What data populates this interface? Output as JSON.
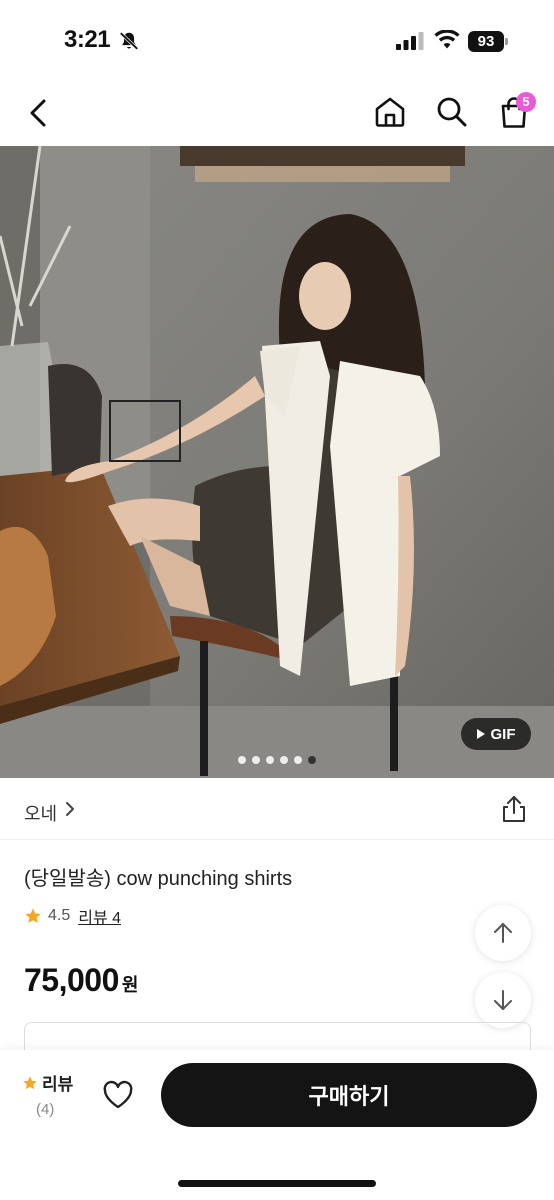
{
  "status_bar": {
    "time": "3:21",
    "battery": "93"
  },
  "nav": {
    "cart_badge": "5"
  },
  "hero": {
    "gif_label": "GIF",
    "slide_count": 6,
    "active_slide": 6
  },
  "product": {
    "brand": "오네",
    "title": "(당일발송) cow punching shirts",
    "rating": "4.5",
    "review_link": "리뷰 4",
    "price": "75,000",
    "price_unit": "원"
  },
  "bottom_bar": {
    "review_label": "리뷰",
    "review_count": "(4)",
    "buy_label": "구매하기"
  },
  "colors": {
    "badge": "#e95ad8",
    "star": "#f5a623",
    "buy_button": "#141414"
  }
}
